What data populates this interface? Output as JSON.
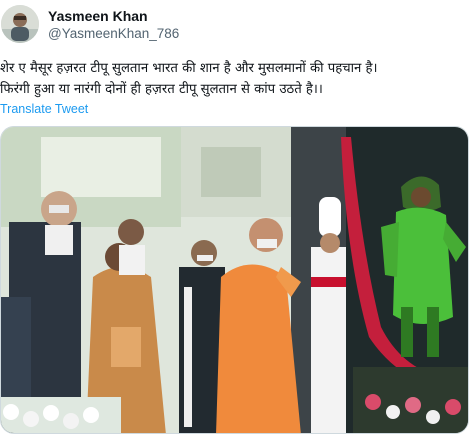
{
  "tweet": {
    "author": {
      "display_name": "Yasmeen Khan",
      "handle": "@YasmeenKhan_786"
    },
    "text_lines": [
      "शेर ए मैसूर हज़रत टीपू सुलतान भारत की शान है और मुसलमानों की पहचान है।",
      "फिरंगी हुआ या नारंगी दोनों ही हज़रत टीपू सुलतान से कांप उठते है।।"
    ],
    "translate_label": "Translate Tweet",
    "media": {
      "kind": "photo"
    }
  },
  "colors": {
    "text": "#0f1419",
    "secondary": "#536471",
    "link": "#1d9bf0",
    "border": "#cfd9de"
  }
}
